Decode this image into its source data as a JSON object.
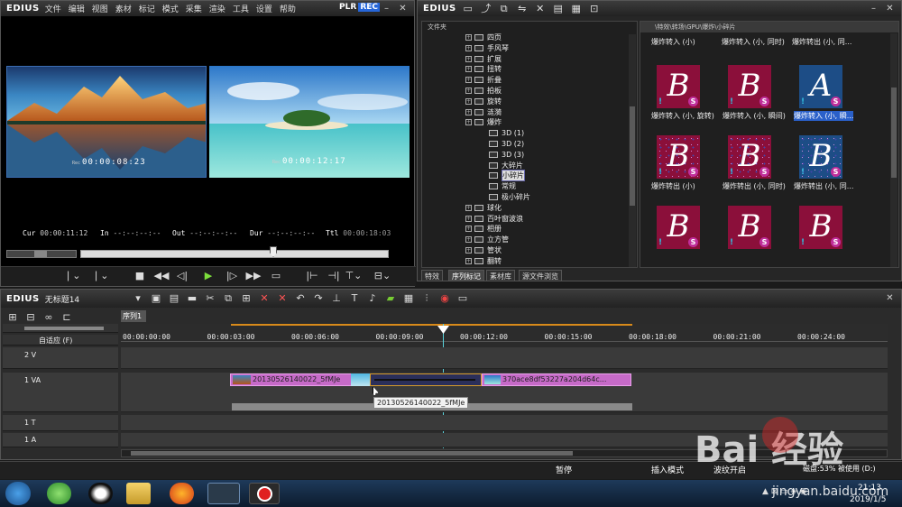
{
  "player": {
    "brand": "EDIUS",
    "menu": [
      "文件",
      "编辑",
      "视图",
      "素材",
      "标记",
      "模式",
      "采集",
      "渲染",
      "工具",
      "设置",
      "帮助"
    ],
    "plr": "PLR",
    "rec": "REC",
    "left_tc_prefix": "Rec",
    "left_tc": "00:00:08:23",
    "right_tc_prefix": "Rec",
    "right_tc": "00:00:12:17",
    "cur_label": "Cur",
    "cur": "00:00:11:12",
    "in_label": "In",
    "in": "--:--:--:--",
    "out_label": "Out",
    "out": "--:--:--:--",
    "dur_label": "Dur",
    "dur": "--:--:--:--",
    "ttl_label": "Ttl",
    "ttl": "00:00:18:03"
  },
  "library": {
    "brand": "EDIUS",
    "tree_header": "文件夹",
    "path": "\\特效\\转场\\GPU\\爆炸\\小碎片",
    "tree": [
      {
        "label": "四页",
        "indent": 0,
        "sel": false
      },
      {
        "label": "手风琴",
        "indent": 0,
        "sel": false
      },
      {
        "label": "扩展",
        "indent": 0,
        "sel": false
      },
      {
        "label": "扭转",
        "indent": 0,
        "sel": false
      },
      {
        "label": "折叠",
        "indent": 0,
        "sel": false
      },
      {
        "label": "拍板",
        "indent": 0,
        "sel": false
      },
      {
        "label": "旋转",
        "indent": 0,
        "sel": false
      },
      {
        "label": "涟漪",
        "indent": 0,
        "sel": false
      },
      {
        "label": "爆炸",
        "indent": 0,
        "sel": false
      },
      {
        "label": "3D (1)",
        "indent": 1,
        "sel": false
      },
      {
        "label": "3D (2)",
        "indent": 1,
        "sel": false
      },
      {
        "label": "3D (3)",
        "indent": 1,
        "sel": false
      },
      {
        "label": "大碎片",
        "indent": 1,
        "sel": false
      },
      {
        "label": "小碎片",
        "indent": 1,
        "sel": true
      },
      {
        "label": "常规",
        "indent": 1,
        "sel": false
      },
      {
        "label": "极小碎片",
        "indent": 1,
        "sel": false
      },
      {
        "label": "球化",
        "indent": 0,
        "sel": false
      },
      {
        "label": "百叶窗波浪",
        "indent": 0,
        "sel": false
      },
      {
        "label": "相册",
        "indent": 0,
        "sel": false
      },
      {
        "label": "立方管",
        "indent": 0,
        "sel": false
      },
      {
        "label": "管状",
        "indent": 0,
        "sel": false
      },
      {
        "label": "翻转",
        "indent": 0,
        "sel": false
      }
    ],
    "top_labels": [
      "爆炸转入 (小)",
      "爆炸转入 (小, 同时)",
      "爆炸转出 (小, 同..."
    ],
    "thumbs": [
      {
        "letter": "B",
        "label": "爆炸转入 (小, 旋转)",
        "sel": false,
        "noise": false,
        "blue": false
      },
      {
        "letter": "B",
        "label": "爆炸转入 (小, 瞬间)",
        "sel": false,
        "noise": false,
        "blue": false
      },
      {
        "letter": "A",
        "label": "爆炸转入 (小, 瞬...",
        "sel": true,
        "noise": false,
        "blue": true
      },
      {
        "letter": "B",
        "label": "爆炸转出 (小)",
        "sel": false,
        "noise": true,
        "blue": false
      },
      {
        "letter": "B",
        "label": "爆炸转出 (小, 同时)",
        "sel": false,
        "noise": true,
        "blue": false
      },
      {
        "letter": "B",
        "label": "爆炸转出 (小, 同...",
        "sel": false,
        "noise": true,
        "blue": true
      },
      {
        "letter": "B",
        "label": "",
        "sel": false,
        "noise": false,
        "blue": false
      },
      {
        "letter": "B",
        "label": "",
        "sel": false,
        "noise": false,
        "blue": false
      },
      {
        "letter": "B",
        "label": "",
        "sel": false,
        "noise": false,
        "blue": false
      }
    ],
    "tabs": [
      "特效",
      "序列标记",
      "素材库",
      "源文件浏览"
    ],
    "active_tab": 1
  },
  "timeline": {
    "brand": "EDIUS",
    "project": "无标题14",
    "sequence_tab": "序列1",
    "mode": "自适应 (F)",
    "ruler": [
      "00:00:00:00",
      "00:00:03:00",
      "00:00:06:00",
      "00:00:09:00",
      "00:00:12:00",
      "00:00:15:00",
      "00:00:18:00",
      "00:00:21:00",
      "00:00:24:00"
    ],
    "tracks": [
      "2 V",
      "1 VA",
      "1 T",
      "1 A"
    ],
    "clip1": "20130526140022_5fMJe",
    "clip2": "370ace8df53227a204d64c...",
    "tooltip": "20130526140022_5fMJe"
  },
  "status": {
    "pause": "暂停",
    "insert_mode": "插入模式",
    "ripple": "波纹开启",
    "disk": "磁盘:53% 被使用 (D:)"
  },
  "taskbar": {
    "time": "21:13",
    "date": "2019/1/5"
  },
  "watermark": {
    "text": "Bai  经验",
    "url": "jingyan.baidu.com"
  }
}
